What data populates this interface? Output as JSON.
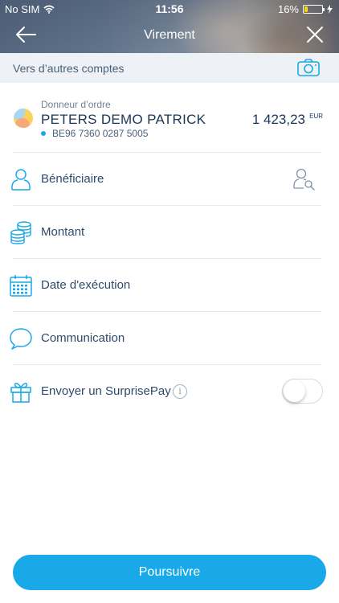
{
  "status_bar": {
    "carrier": "No SIM",
    "time": "11:56",
    "battery": "16%",
    "battery_level": 0.16
  },
  "nav": {
    "title": "Virement",
    "back_icon": "arrow-left-icon",
    "close_icon": "close-icon"
  },
  "subbar": {
    "label": "Vers d’autres comptes",
    "camera_icon": "camera-icon"
  },
  "payer": {
    "label": "Donneur d’ordre",
    "name": "PETERS DEMO PATRICK",
    "iban": "BE96 7360 0287 5005",
    "amount": "1 423,23",
    "currency": "EUR"
  },
  "fields": [
    {
      "label": "Bénéficiaire",
      "icon": "person-icon",
      "action_icon": "search-person-icon"
    },
    {
      "label": "Montant",
      "icon": "coins-icon"
    },
    {
      "label": "Date d'exécution",
      "icon": "calendar-icon"
    },
    {
      "label": "Communication",
      "icon": "speech-bubble-icon"
    },
    {
      "label": "Envoyer un SurprisePay",
      "icon": "gift-icon",
      "info": "i",
      "toggle_on": false
    }
  ],
  "cta": {
    "label": "Poursuivre"
  },
  "colors": {
    "accent": "#19a9e8",
    "text_dark": "#1a3658",
    "icon": "#19a9e8"
  }
}
